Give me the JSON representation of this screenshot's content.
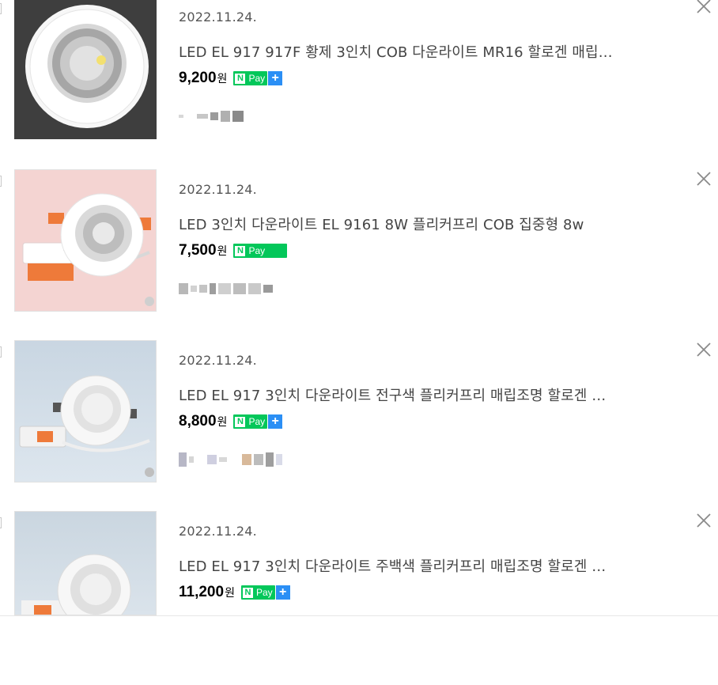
{
  "items": [
    {
      "date": "2022.11.24.",
      "title": "LED EL 917 917F 황제 3인치 COB 다운라이트 MR16 할로겐 매립…",
      "price": "9,200",
      "currency": "원",
      "pay_label": "Pay",
      "pay_n": "N",
      "pay_plus": "+"
    },
    {
      "date": "2022.11.24.",
      "title": "LED 3인치 다운라이트 EL 9161 8W 플리커프리 COB 집중형 8w",
      "price": "7,500",
      "currency": "원",
      "pay_label": "Pay",
      "pay_n": "N"
    },
    {
      "date": "2022.11.24.",
      "title": "LED EL 917 3인치 다운라이트 전구색 플리커프리 매립조명 할로겐 …",
      "price": "8,800",
      "currency": "원",
      "pay_label": "Pay",
      "pay_n": "N",
      "pay_plus": "+"
    },
    {
      "date": "2022.11.24.",
      "title": "LED EL 917 3인치 다운라이트 주백색 플리커프리 매립조명 할로겐 …",
      "price": "11,200",
      "currency": "원",
      "pay_label": "Pay",
      "pay_n": "N",
      "pay_plus": "+"
    }
  ],
  "colors": {
    "npay_green": "#03c75a",
    "npay_blue": "#2b8ff5",
    "price": "#000000",
    "text": "#444444"
  },
  "icons": {
    "close": "close-icon",
    "checkbox": "checkbox",
    "npay": "npay-badge"
  }
}
